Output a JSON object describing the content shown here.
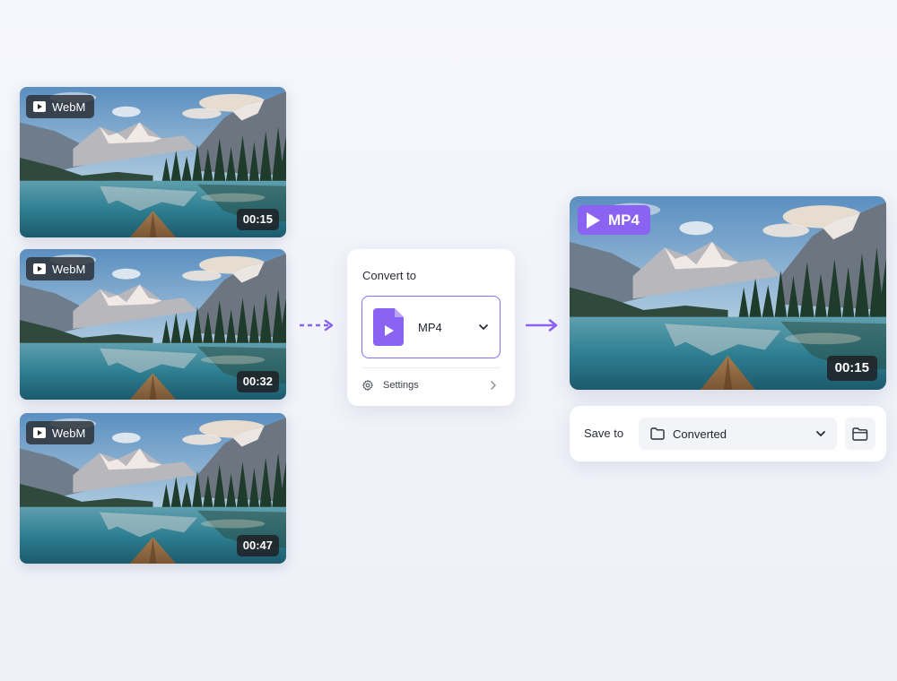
{
  "inputs": [
    {
      "format": "WebM",
      "duration": "00:15"
    },
    {
      "format": "WebM",
      "duration": "00:32"
    },
    {
      "format": "WebM",
      "duration": "00:47"
    }
  ],
  "converter": {
    "title": "Convert to",
    "selected_format": "MP4",
    "settings_label": "Settings"
  },
  "output": {
    "format": "MP4",
    "duration": "00:15",
    "save_label": "Save to",
    "folder": "Converted"
  },
  "colors": {
    "accent": "#8b63f2",
    "badge_dark": "#2a2a2e",
    "background": "#f3f4fa"
  },
  "icons": [
    "video-icon",
    "play-icon",
    "file-video-icon",
    "chevron-down-icon",
    "gear-icon",
    "chevron-right-icon",
    "folder-icon",
    "folder-open-icon",
    "arrow-right-icon"
  ]
}
